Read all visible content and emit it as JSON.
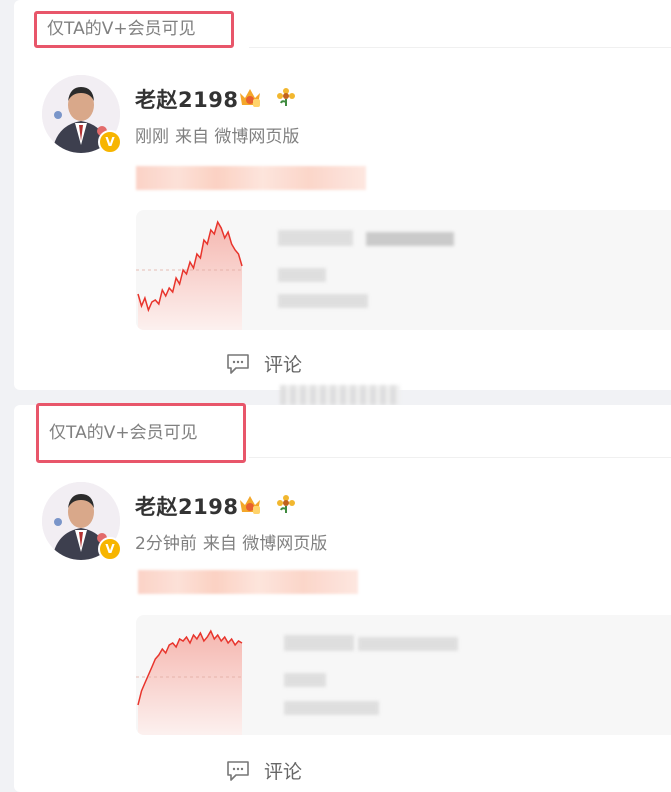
{
  "posts": [
    {
      "visibility_label": "仅TA的V+会员可见",
      "username": "老赵2198",
      "time": "刚刚",
      "source": "来自 微博网页版",
      "comment_label": "评论",
      "chart_data": {
        "type": "line",
        "description_values": [
          58,
          52,
          56,
          50,
          54,
          55,
          53,
          60,
          57,
          61,
          59,
          66,
          63,
          70,
          68,
          74,
          71,
          78,
          76,
          85,
          83,
          90,
          88,
          94,
          91,
          86,
          89,
          83,
          80,
          78,
          72
        ],
        "ylim": [
          40,
          100
        ]
      }
    },
    {
      "visibility_label": "仅TA的V+会员可见",
      "username": "老赵2198",
      "time": "2分钟前",
      "source": "来自 微博网页版",
      "comment_label": "评论",
      "chart_data": {
        "type": "line",
        "description_values": [
          55,
          62,
          66,
          70,
          74,
          78,
          80,
          83,
          81,
          85,
          86,
          84,
          88,
          87,
          89,
          86,
          90,
          88,
          91,
          87,
          89,
          92,
          88,
          90,
          87,
          89,
          86,
          88,
          85,
          87,
          86
        ],
        "ylim": [
          40,
          100
        ]
      }
    }
  ],
  "colors": {
    "label_border": "#e8566a",
    "chart_line": "#e8342c",
    "badge": "#f7b500"
  }
}
